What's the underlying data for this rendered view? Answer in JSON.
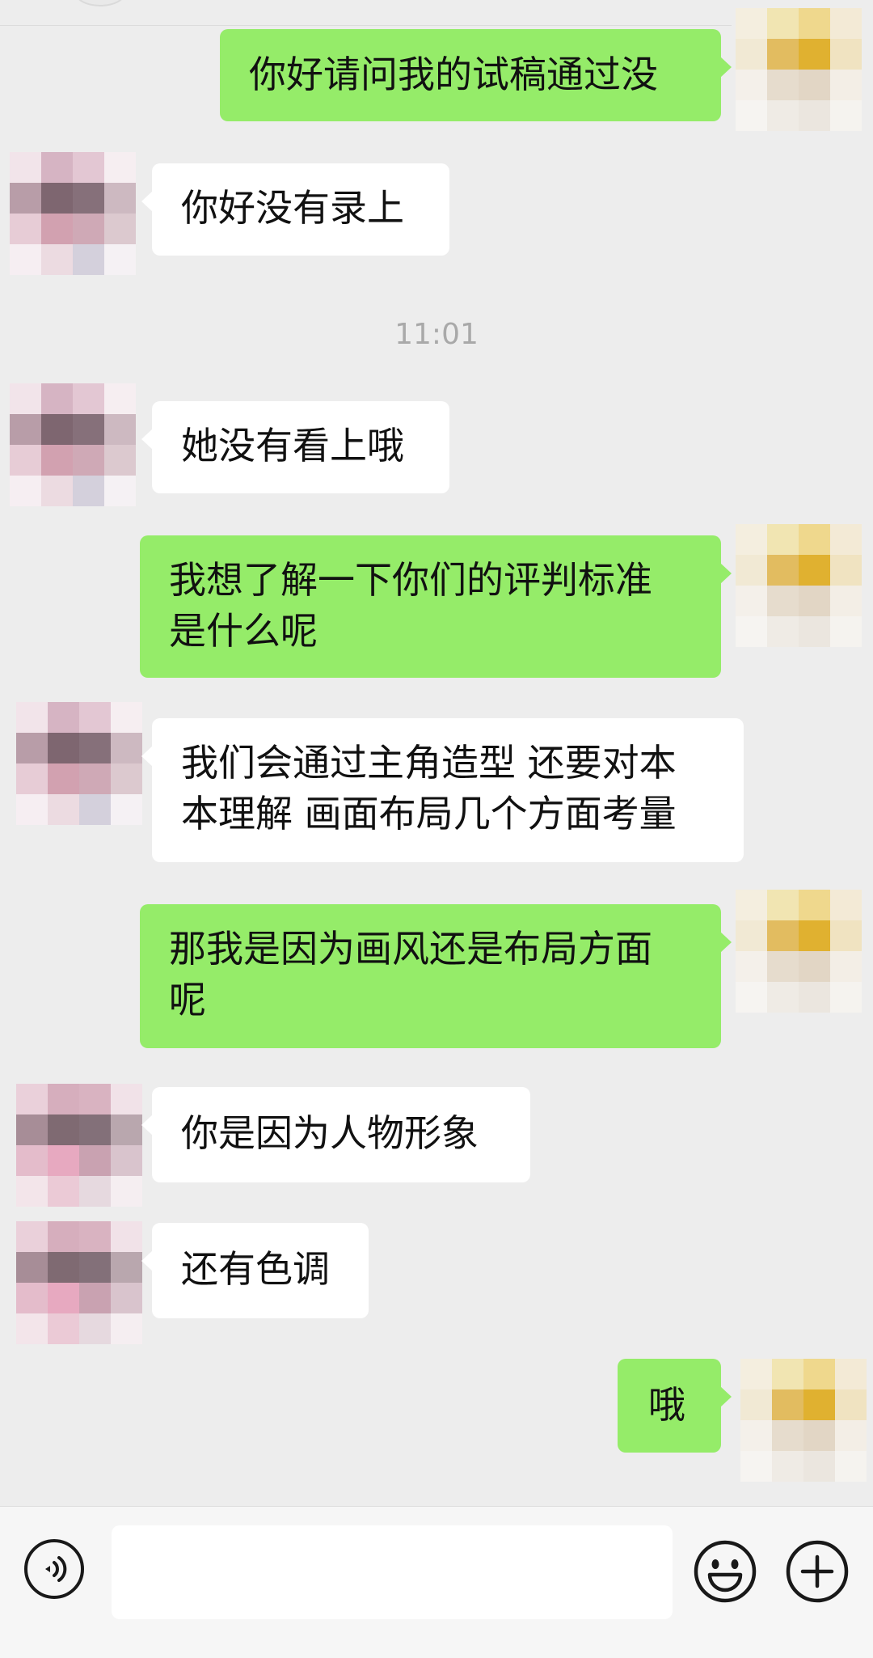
{
  "messages": [
    {
      "side": "right",
      "lines": [
        "你好请问我的试稿通过没"
      ]
    },
    {
      "side": "left",
      "lines": [
        "你好没有录上"
      ]
    },
    {
      "side": "left",
      "lines": [
        "她没有看上哦"
      ]
    },
    {
      "side": "right",
      "lines": [
        "我想了解一下你们的评判标准",
        "是什么呢"
      ]
    },
    {
      "side": "left",
      "lines": [
        "我们会通过主角造型 还要对本",
        "本理解 画面布局几个方面考量"
      ]
    },
    {
      "side": "right",
      "lines": [
        "那我是因为画风还是布局方面",
        "呢"
      ]
    },
    {
      "side": "left",
      "lines": [
        "你是因为人物形象"
      ]
    },
    {
      "side": "left",
      "lines": [
        "还有色调"
      ]
    },
    {
      "side": "right",
      "lines": [
        "哦"
      ]
    }
  ],
  "timestamp": "11:01",
  "input": {
    "value": "",
    "placeholder": ""
  },
  "icons": {
    "voice": "voice-icon",
    "emoji": "emoji-icon",
    "plus": "plus-icon"
  },
  "colors": {
    "background": "#ededed",
    "sent_bubble": "#95ec69",
    "received_bubble": "#ffffff",
    "timestamp_text": "#a9a9a9",
    "input_bar": "#f6f6f6"
  }
}
